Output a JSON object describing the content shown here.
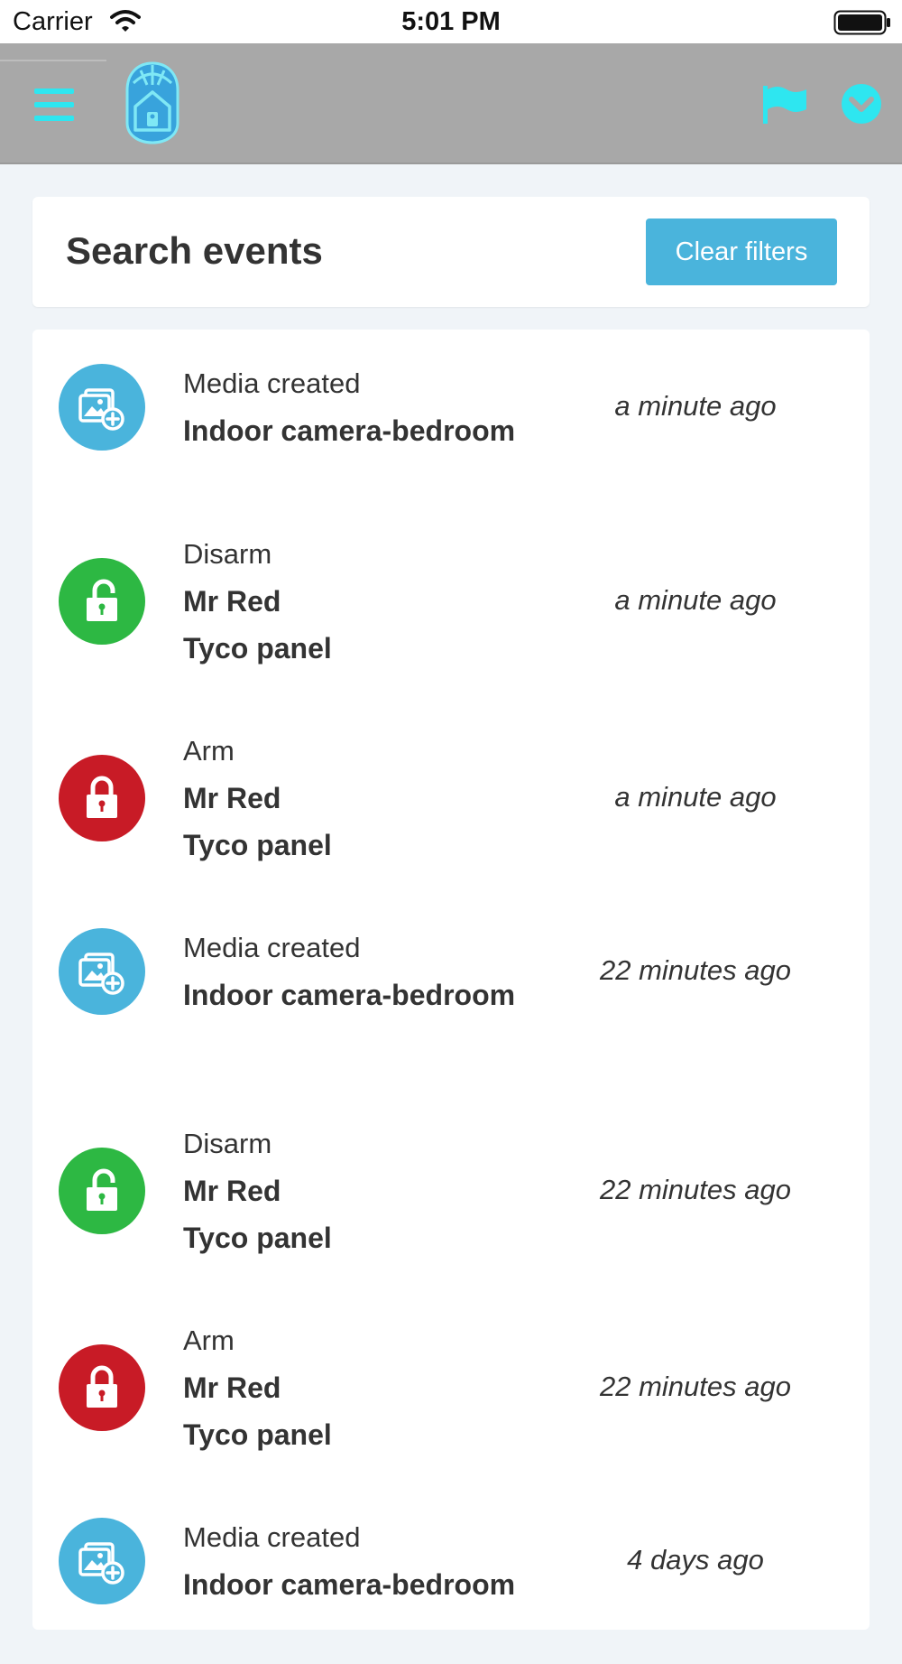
{
  "status_bar": {
    "carrier": "Carrier",
    "time": "5:01 PM"
  },
  "header": {
    "icons": [
      "menu-icon",
      "logo-icon",
      "flag-icon",
      "chevron-down-icon"
    ],
    "accent_color": "#2ee6f0"
  },
  "search": {
    "title": "Search events",
    "clear_label": "Clear filters"
  },
  "colors": {
    "media": "#4ab4dc",
    "disarm": "#2db843",
    "arm": "#c81b26",
    "button": "#4ab4dc"
  },
  "events": [
    {
      "kind": "media",
      "icon": "media-add-icon",
      "type": "Media created",
      "details": [
        "Indoor camera-bedroom"
      ],
      "time": "a minute ago"
    },
    {
      "kind": "disarm",
      "icon": "unlock-icon",
      "type": "Disarm",
      "details": [
        "Mr Red",
        "Tyco panel"
      ],
      "time": "a minute ago"
    },
    {
      "kind": "arm",
      "icon": "lock-icon",
      "type": "Arm",
      "details": [
        "Mr Red",
        "Tyco panel"
      ],
      "time": "a minute ago"
    },
    {
      "kind": "media",
      "icon": "media-add-icon",
      "type": "Media created",
      "details": [
        "Indoor camera-bedroom"
      ],
      "time": "22 minutes ago"
    },
    {
      "kind": "disarm",
      "icon": "unlock-icon",
      "type": "Disarm",
      "details": [
        "Mr Red",
        "Tyco panel"
      ],
      "time": "22 minutes ago"
    },
    {
      "kind": "arm",
      "icon": "lock-icon",
      "type": "Arm",
      "details": [
        "Mr Red",
        "Tyco panel"
      ],
      "time": "22 minutes ago"
    },
    {
      "kind": "media",
      "icon": "media-add-icon",
      "type": "Media created",
      "details": [
        "Indoor camera-bedroom"
      ],
      "time": "4 days ago"
    }
  ]
}
